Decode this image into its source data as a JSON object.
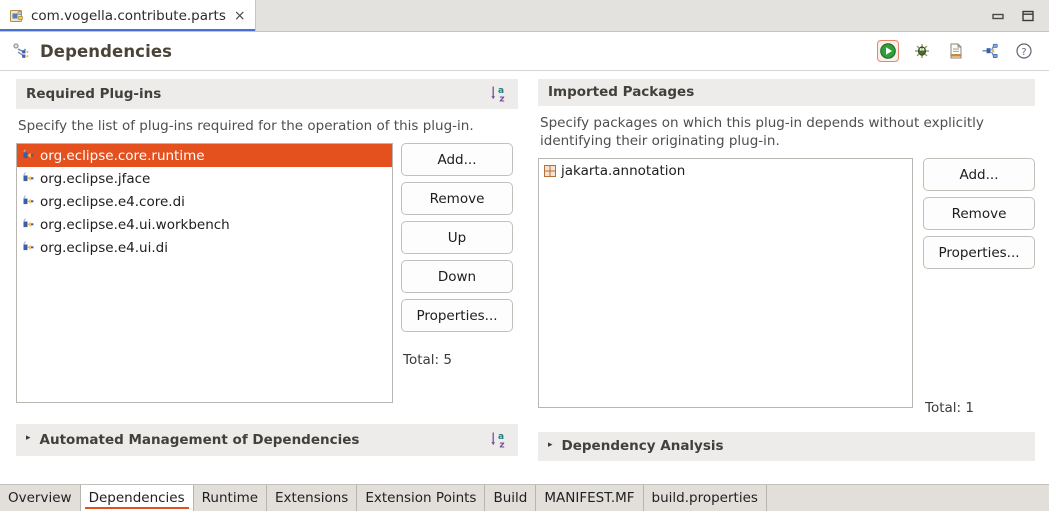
{
  "window": {
    "minimize_label": "Minimize",
    "maximize_label": "Maximize"
  },
  "editor_tab": {
    "label": "com.vogella.contribute.parts",
    "close_label": "×",
    "icon": "plugin-manifest-icon"
  },
  "form": {
    "title": "Dependencies",
    "title_icon": "dependencies-icon",
    "toolbar": [
      {
        "name": "run-button",
        "title": "Run",
        "icon": "run-green-play-icon",
        "highlighted": true
      },
      {
        "name": "debug-button",
        "title": "Debug",
        "icon": "debug-bug-icon",
        "highlighted": false
      },
      {
        "name": "open-manifest-button",
        "title": "Open Manifest",
        "icon": "document-icon",
        "highlighted": false
      },
      {
        "name": "export-button",
        "title": "Export Wizard",
        "icon": "export-plugin-icon",
        "highlighted": false
      },
      {
        "name": "help-button",
        "title": "Help",
        "icon": "help-question-icon",
        "highlighted": false
      }
    ]
  },
  "required_plugins": {
    "header": "Required Plug-ins",
    "sort_icon": "sort-az-icon",
    "description": "Specify the list of plug-ins required for the operation of this plug-in.",
    "items": [
      {
        "label": "org.eclipse.core.runtime",
        "icon": "plugin-icon",
        "selected": true
      },
      {
        "label": "org.eclipse.jface",
        "icon": "plugin-icon",
        "selected": false
      },
      {
        "label": "org.eclipse.e4.core.di",
        "icon": "plugin-icon",
        "selected": false
      },
      {
        "label": "org.eclipse.e4.ui.workbench",
        "icon": "plugin-icon",
        "selected": false
      },
      {
        "label": "org.eclipse.e4.ui.di",
        "icon": "plugin-icon",
        "selected": false
      }
    ],
    "buttons": [
      {
        "name": "add-button",
        "label": "Add..."
      },
      {
        "name": "remove-button",
        "label": "Remove"
      },
      {
        "name": "up-button",
        "label": "Up"
      },
      {
        "name": "down-button",
        "label": "Down"
      },
      {
        "name": "properties-button",
        "label": "Properties..."
      }
    ],
    "total": "Total: 5"
  },
  "imported_packages": {
    "header": "Imported Packages",
    "description": "Specify packages on which this plug-in depends without explicitly identifying their originating plug-in.",
    "items": [
      {
        "label": "jakarta.annotation",
        "icon": "package-icon",
        "selected": false
      }
    ],
    "buttons": [
      {
        "name": "add-button",
        "label": "Add..."
      },
      {
        "name": "remove-button",
        "label": "Remove"
      },
      {
        "name": "properties-button",
        "label": "Properties..."
      }
    ],
    "total": "Total: 1"
  },
  "automated_management": {
    "header": "Automated Management of Dependencies",
    "twisty": "▸",
    "sort_icon": "sort-az-icon"
  },
  "dependency_analysis": {
    "header": "Dependency Analysis",
    "twisty": "▸"
  },
  "page_tabs": [
    {
      "name": "tab-overview",
      "label": "Overview",
      "active": false
    },
    {
      "name": "tab-dependencies",
      "label": "Dependencies",
      "active": true
    },
    {
      "name": "tab-runtime",
      "label": "Runtime",
      "active": false
    },
    {
      "name": "tab-extensions",
      "label": "Extensions",
      "active": false
    },
    {
      "name": "tab-extension-points",
      "label": "Extension Points",
      "active": false
    },
    {
      "name": "tab-build",
      "label": "Build",
      "active": false
    },
    {
      "name": "tab-manifest-mf",
      "label": "MANIFEST.MF",
      "active": false
    },
    {
      "name": "tab-build-properties",
      "label": "build.properties",
      "active": false
    }
  ],
  "colors": {
    "selection": "#e4501e",
    "active_tab_underline": "#4a6fd0",
    "page_tab_underline": "#e4501e",
    "section_header_bg": "#edecea",
    "title_text": "#4a4338"
  }
}
